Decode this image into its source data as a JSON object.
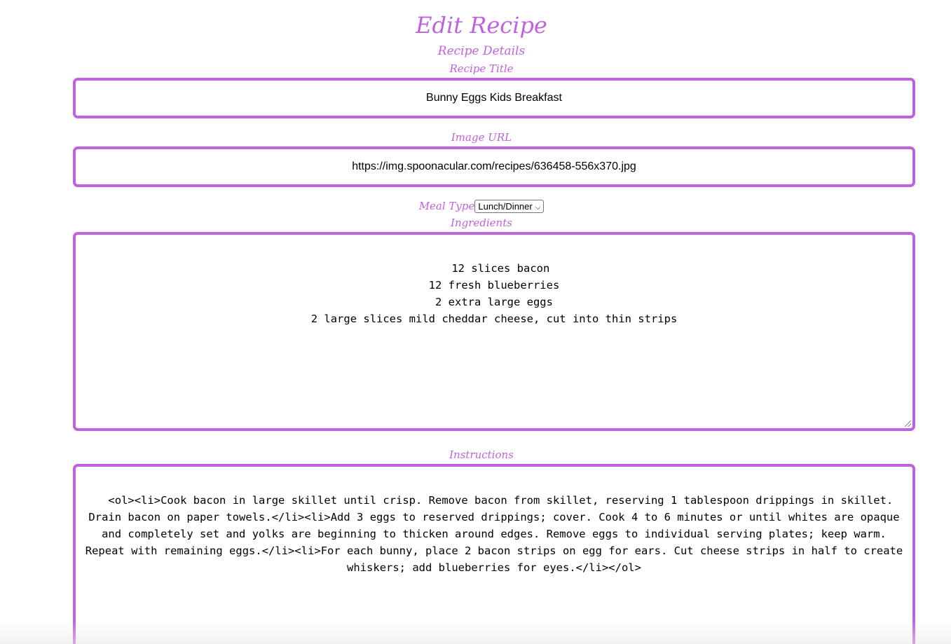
{
  "page": {
    "title": "Edit Recipe",
    "section_title": "Recipe Details"
  },
  "fields": {
    "recipe_title": {
      "label": "Recipe Title",
      "value": "Bunny Eggs Kids Breakfast"
    },
    "image_url": {
      "label": "Image URL",
      "value": "https://img.spoonacular.com/recipes/636458-556x370.jpg"
    },
    "meal_type": {
      "label": "Meal Type",
      "selected": "Lunch/Dinner"
    },
    "ingredients": {
      "label": "Ingredients",
      "value": "12 slices bacon\n12 fresh blueberries\n2 extra large eggs\n2 large slices mild cheddar cheese, cut into thin strips"
    },
    "instructions": {
      "label": "Instructions",
      "value": "<ol><li>Cook bacon in large skillet until crisp. Remove bacon from skillet, reserving 1 tablespoon drippings in skillet. Drain bacon on paper towels.</li><li>Add 3 eggs to reserved drippings; cover. Cook 4 to 6 minutes or until whites are opaque and completely set and yolks are beginning to thicken around edges. Remove eggs to individual serving plates; keep warm. Repeat with remaining eggs.</li><li>For each bunny, place 2 bacon strips on egg for ears. Cut cheese strips in half to create whiskers; add blueberries for eyes.</li></ol>"
    }
  },
  "colors": {
    "accent": "#c062e0"
  },
  "icons": {
    "select_chevron": "chevron-down-icon",
    "resize": "resize-grip-icon"
  }
}
